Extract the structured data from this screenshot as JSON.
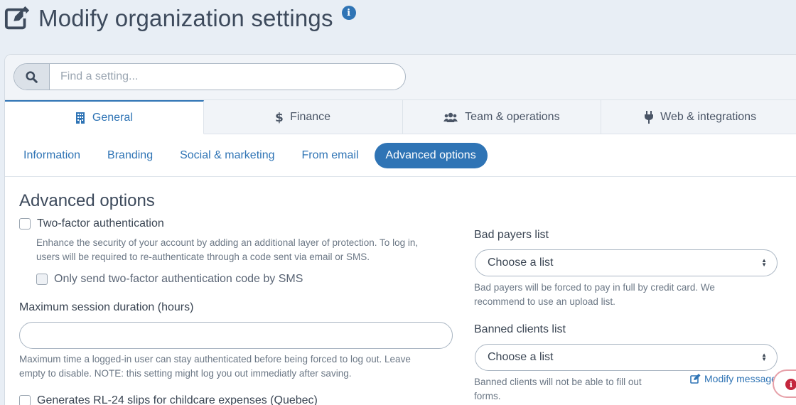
{
  "header": {
    "title": "Modify organization settings",
    "icon": "edit-icon",
    "info_icon": "info-icon",
    "info_glyph": "i"
  },
  "search": {
    "placeholder": "Find a setting...",
    "value": ""
  },
  "tabs": [
    {
      "label": "General",
      "icon": "building-icon",
      "active": true
    },
    {
      "label": "Finance",
      "icon": "dollar-icon",
      "active": false
    },
    {
      "label": "Team & operations",
      "icon": "users-icon",
      "active": false
    },
    {
      "label": "Web & integrations",
      "icon": "plug-icon",
      "active": false
    }
  ],
  "subtabs": [
    {
      "label": "Information",
      "active": false
    },
    {
      "label": "Branding",
      "active": false
    },
    {
      "label": "Social & marketing",
      "active": false
    },
    {
      "label": "From email",
      "active": false
    },
    {
      "label": "Advanced options",
      "active": true
    }
  ],
  "section": {
    "title": "Advanced options",
    "two_factor": {
      "label": "Two-factor authentication",
      "checked": false,
      "help_line1": "Enhance the security of your account by adding an additional layer of protection. To log in,",
      "help_line2": "users will be required to re-authenticate through a code sent via email or SMS.",
      "sms_only_label": "Only send two-factor authentication code by SMS",
      "sms_only_checked": false
    },
    "session": {
      "label": "Maximum session duration (hours)",
      "value": "",
      "help_line1": "Maximum time a logged-in user can stay authenticated before being forced to log out. Leave",
      "help_line2": "empty to disable. NOTE: this setting might log you out immediatly after saving."
    },
    "rl24": {
      "label": "Generates RL-24 slips for childcare expenses (Quebec)",
      "checked": false
    },
    "bad_payers": {
      "label": "Bad payers list",
      "selected": "Choose a list",
      "help_line1": "Bad payers will be forced to pay in full by credit card. We",
      "help_line2": "recommend to use an upload list."
    },
    "banned_clients": {
      "label": "Banned clients list",
      "selected": "Choose a list",
      "help_line1": "Banned clients will not be able to fill out",
      "help_line2": "forms.",
      "modify_link": "Modify message"
    }
  },
  "colors": {
    "accent": "#2f74b5",
    "background": "#e8eef5",
    "alert": "#c4263d"
  },
  "float_badge": {
    "icon": "info-icon",
    "glyph": "i"
  }
}
